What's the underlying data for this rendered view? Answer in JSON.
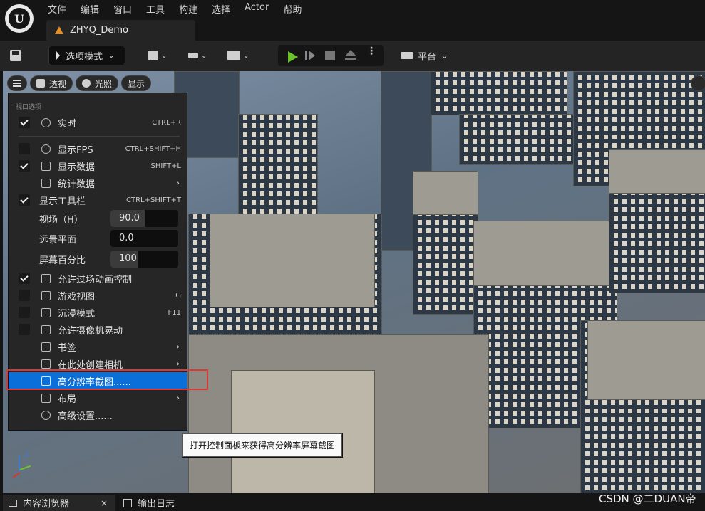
{
  "menu": {
    "items": [
      "文件",
      "编辑",
      "窗口",
      "工具",
      "构建",
      "选择",
      "Actor",
      "帮助"
    ]
  },
  "document_tab": {
    "title": "ZHYQ_Demo"
  },
  "toolbar": {
    "mode_label": "选项模式",
    "platform_label": "平台"
  },
  "viewport_controls": {
    "perspective": "透视",
    "lighting": "光照",
    "show": "显示"
  },
  "viewport_menu": {
    "section_title": "视口选项",
    "realtime": {
      "label": "实时",
      "shortcut": "CTRL+R",
      "checked": true
    },
    "show_fps": {
      "label": "显示FPS",
      "shortcut": "CTRL+SHIFT+H",
      "checked": false
    },
    "show_stats": {
      "label": "显示数据",
      "shortcut": "SHIFT+L",
      "checked": true
    },
    "stat_data": {
      "label": "统计数据"
    },
    "show_toolbar": {
      "label": "显示工具栏",
      "shortcut": "CTRL+SHIFT+T",
      "checked": true
    },
    "fov": {
      "label": "视场（H）",
      "value": "90.0",
      "fill_fraction": 0.5
    },
    "far_plane": {
      "label": "远景平面",
      "value": "0.0",
      "fill_fraction": 0.0
    },
    "screen_percentage": {
      "label": "屏幕百分比",
      "value": "100",
      "fill_fraction": 0.4
    },
    "cinematic_control": {
      "label": "允许过场动画控制",
      "checked": true
    },
    "game_view": {
      "label": "游戏视图",
      "shortcut": "G",
      "checked": false
    },
    "immersive": {
      "label": "沉浸模式",
      "shortcut": "F11",
      "checked": false
    },
    "camera_shake": {
      "label": "允许摄像机晃动",
      "checked": false
    },
    "bookmarks": {
      "label": "书签"
    },
    "create_camera": {
      "label": "在此处创建相机"
    },
    "hires_screenshot": {
      "label": "高分辨率截图......"
    },
    "layout": {
      "label": "布局"
    },
    "advanced": {
      "label": "高级设置......"
    }
  },
  "tooltip": {
    "text": "打开控制面板来获得高分辨率屏幕截图"
  },
  "axis": {
    "z_label": "Z"
  },
  "bottom_tabs": {
    "content_browser": "内容浏览器",
    "output_log": "输出日志",
    "close_glyph": "×"
  },
  "watermark": "CSDN @二DUAN帝"
}
